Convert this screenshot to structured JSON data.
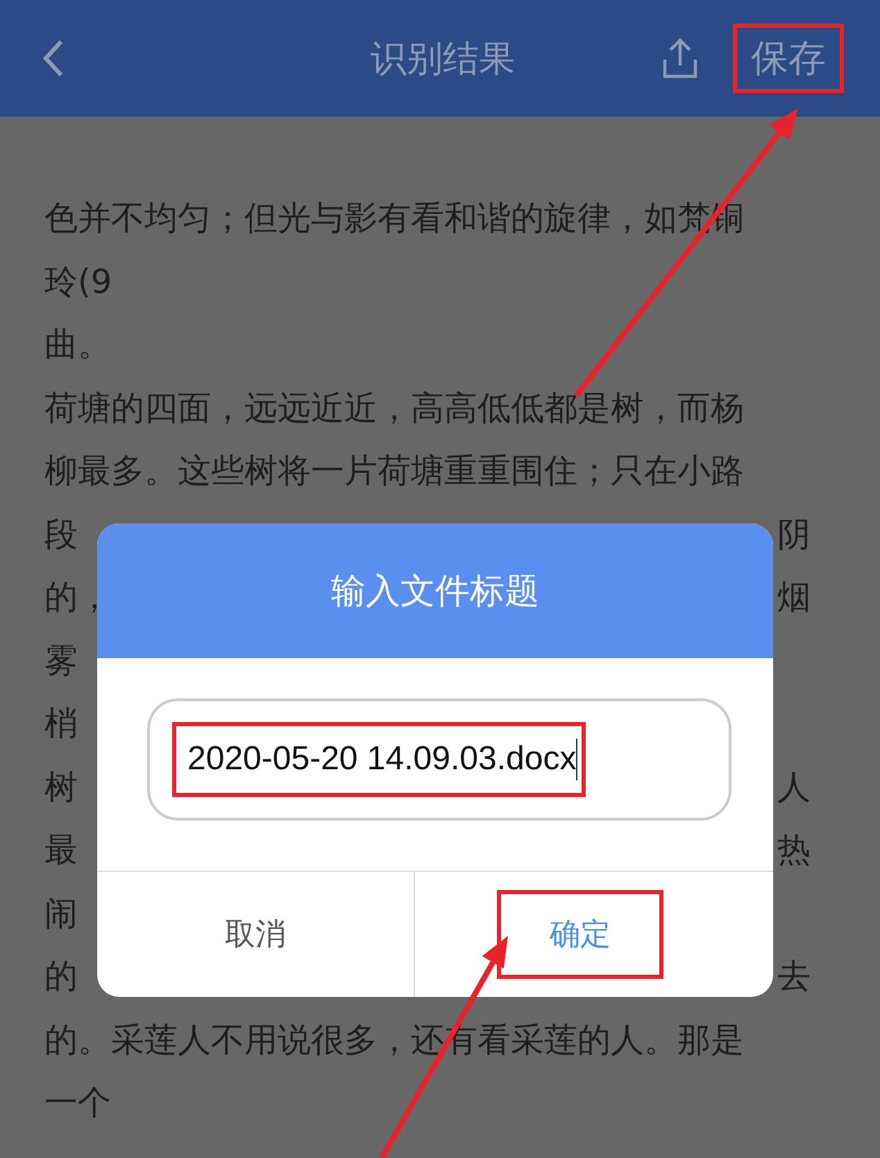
{
  "header": {
    "title": "识别结果",
    "save": {
      "label": "保存",
      "highlighted": true
    }
  },
  "lines": [
    {
      "left": "色并不均匀；但光与影有看和谐的旋律，如梵铜"
    },
    {
      "left": "玲(9"
    },
    {
      "left": "曲。"
    },
    {
      "left": "荷塘的四面，远远近近，高高低低都是树，而杨"
    },
    {
      "left": "柳最多。这些树将一片荷塘重重围住；只在小路"
    },
    {
      "left": "段",
      "right": "阴"
    },
    {
      "left": "的，",
      "right": "烟"
    },
    {
      "left": "雾"
    },
    {
      "left": "梢"
    },
    {
      "left": "树",
      "right": "人"
    },
    {
      "left": "最",
      "right": "热"
    },
    {
      "left": "闹"
    },
    {
      "left": "的",
      "right": "去"
    },
    {
      "left": "的。采莲人不用说很多，还有看采莲的人。那是"
    },
    {
      "left": "一个"
    }
  ],
  "dialog": {
    "title": "输入文件标题",
    "input": {
      "value": "2020-05-20 14.09.03.docx",
      "highlighted": true
    },
    "buttons": [
      {
        "label": "取消",
        "kind": "cancel",
        "highlighted": false
      },
      {
        "label": "确定",
        "kind": "confirm",
        "highlighted": true
      }
    ]
  }
}
